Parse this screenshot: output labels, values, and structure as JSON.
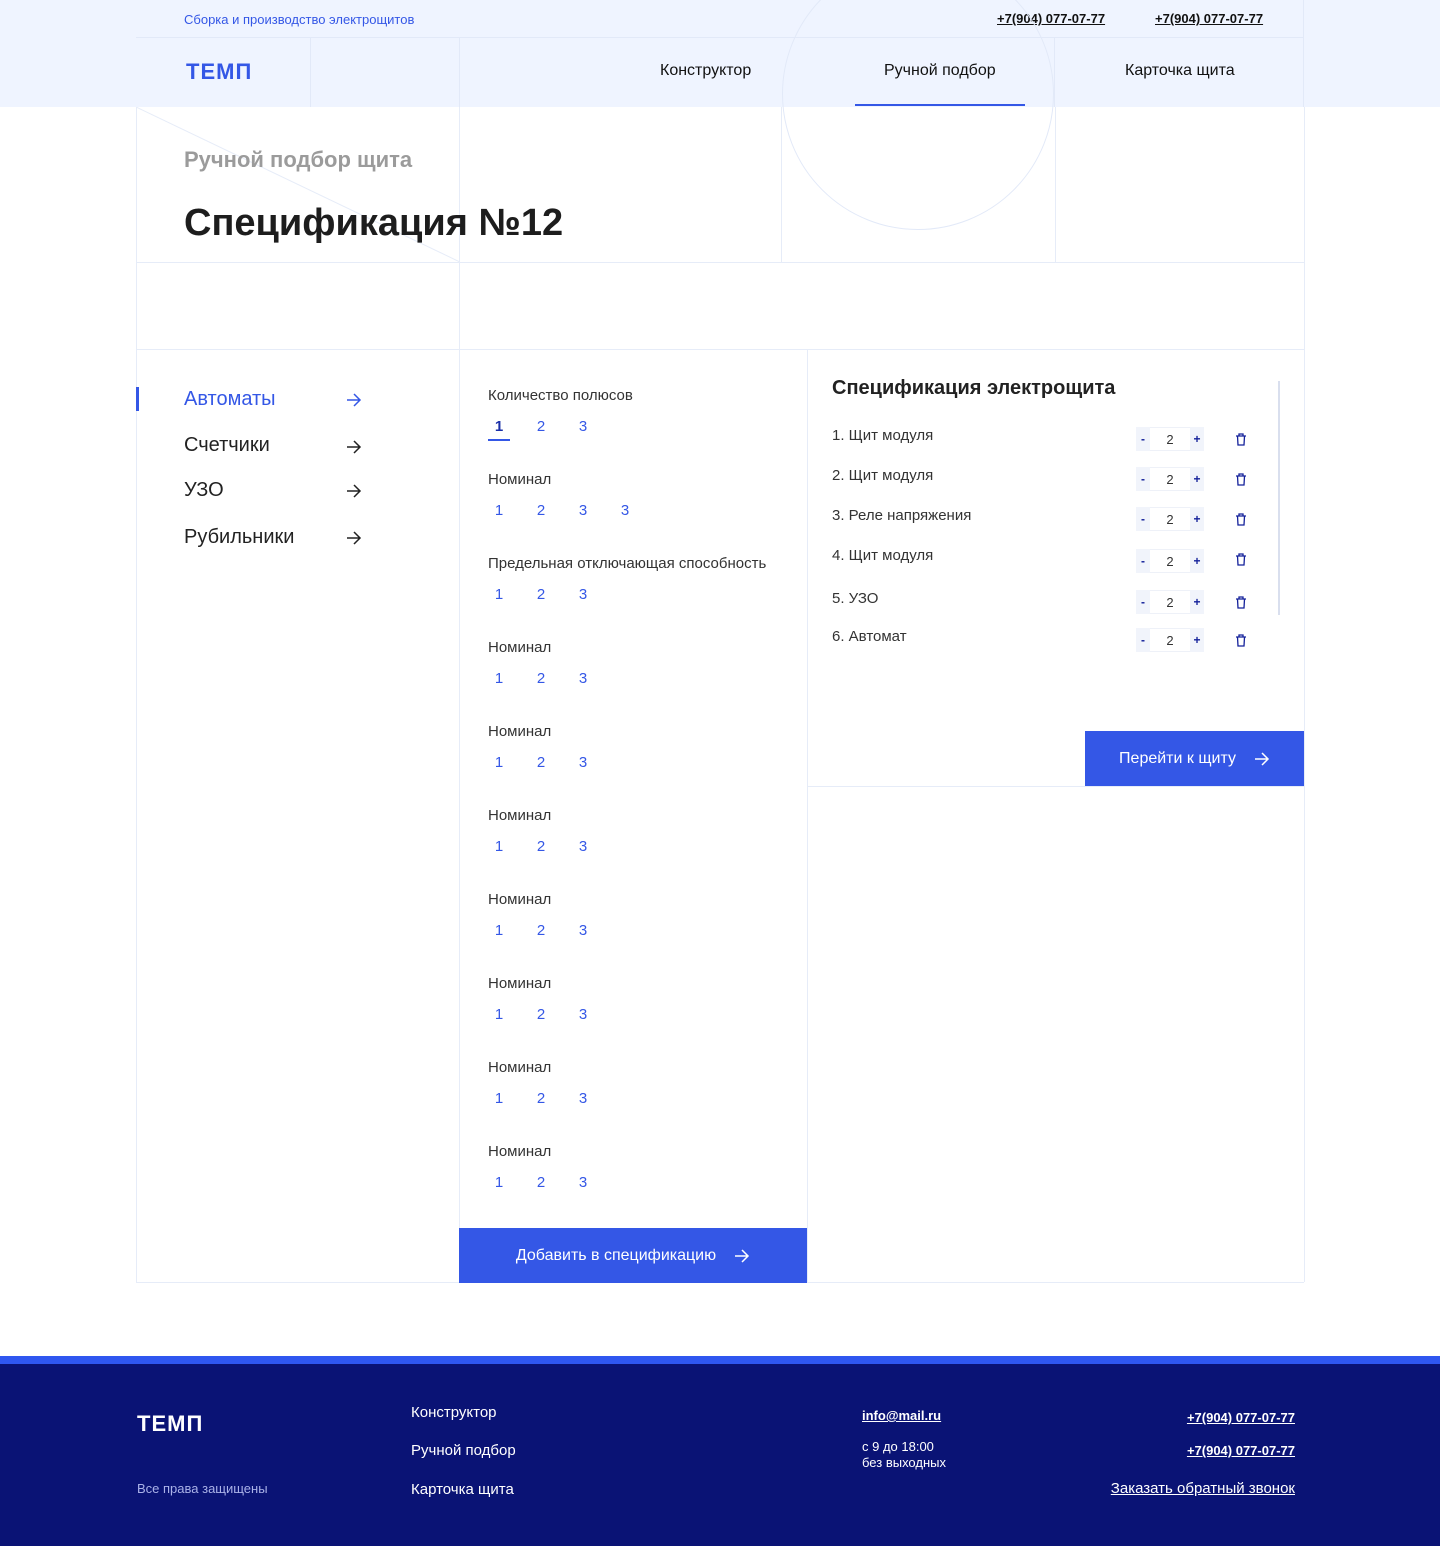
{
  "header": {
    "tagline": "Сборка и производство электрощитов",
    "phones": [
      "+7(904) 077-07-77",
      "+7(904) 077-07-77"
    ],
    "logo": "ТЕМП",
    "nav": [
      {
        "label": "Конструктор"
      },
      {
        "label": "Ручной подбор",
        "active": true
      },
      {
        "label": "Карточка щита"
      }
    ]
  },
  "page": {
    "subtitle": "Ручной подбор щита",
    "title": "Спецификация №12"
  },
  "sidebar": {
    "items": [
      {
        "label": "Автоматы",
        "active": true
      },
      {
        "label": "Счетчики"
      },
      {
        "label": "УЗО"
      },
      {
        "label": "Рубильники"
      }
    ]
  },
  "filters": [
    {
      "label": "Количество полюсов",
      "options": [
        "1",
        "2",
        "3"
      ],
      "selected": "1"
    },
    {
      "label": "Номинал",
      "options": [
        "1",
        "2",
        "3",
        "3"
      ]
    },
    {
      "label": "Предельная отключающая способность",
      "options": [
        "1",
        "2",
        "3"
      ]
    },
    {
      "label": "Номинал",
      "options": [
        "1",
        "2",
        "3"
      ]
    },
    {
      "label": "Номинал",
      "options": [
        "1",
        "2",
        "3"
      ]
    },
    {
      "label": "Номинал",
      "options": [
        "1",
        "2",
        "3"
      ]
    },
    {
      "label": "Номинал",
      "options": [
        "1",
        "2",
        "3"
      ]
    },
    {
      "label": "Номинал",
      "options": [
        "1",
        "2",
        "3"
      ]
    },
    {
      "label": "Номинал",
      "options": [
        "1",
        "2",
        "3"
      ]
    },
    {
      "label": "Номинал",
      "options": [
        "1",
        "2",
        "3"
      ]
    }
  ],
  "add_button": "Добавить в спецификацию",
  "spec": {
    "title": "Спецификация электрощита",
    "items": [
      {
        "label": "1. Щит модуля",
        "qty": "2"
      },
      {
        "label": "2. Щит модуля",
        "qty": "2"
      },
      {
        "label": "3. Реле напряжения",
        "qty": "2"
      },
      {
        "label": "4. Щит модуля",
        "qty": "2"
      },
      {
        "label": "5. УЗО",
        "qty": "2"
      },
      {
        "label": "6. Автомат",
        "qty": "2"
      }
    ],
    "minus": "-",
    "plus": "+",
    "go_button": "Перейти к щиту"
  },
  "footer": {
    "logo": "ТЕМП",
    "rights": "Все права защищены",
    "links": [
      "Конструктор",
      "Ручной подбор",
      "Карточка щита"
    ],
    "email": "info@mail.ru",
    "hours_line1": "с 9 до 18:00",
    "hours_line2": "без выходных",
    "phones": [
      "+7(904) 077-07-77",
      "+7(904) 077-07-77"
    ],
    "callback": "Заказать обратный звонок"
  },
  "colors": {
    "accent": "#3457e6",
    "header_bg": "#eff4ff",
    "footer_bg": "#0a1375",
    "footer_stripe": "#2f57f0"
  },
  "icons": {
    "menu_arrow": "arrow-right-icon",
    "delete": "trash-icon"
  }
}
